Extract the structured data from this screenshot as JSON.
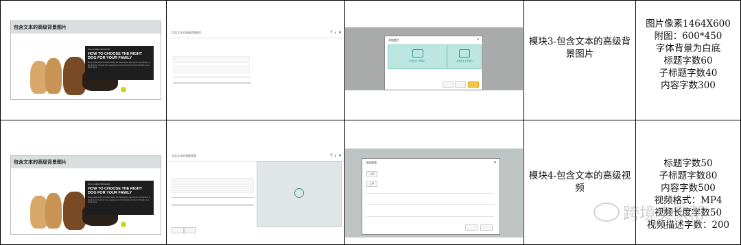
{
  "rows": [
    {
      "preview_title": "包含文本的高级背景图片",
      "overlay_small": "DOG CARE PROGRAM",
      "overlay_heading": "HOW TO CHOOSE THE RIGHT DOG FOR YOUR FAMILY",
      "overlay_body": "Many people know a lot about dogs, but choosing the right dog for your family is a big decision. Consider size, energy level and temperament before bringing a new friend home.",
      "editor_title": "包含文本的高级背景图片",
      "dialog_title": "添加图片",
      "dialog_upload_label": "点击此处上传图片",
      "module_name": "模块3-包含文本的高级背景图片",
      "specs": [
        "图片像素1464X600",
        "附图：600*450",
        "字体背景为白底",
        "标题字数60",
        "子标题字数40",
        "内容字数300"
      ]
    },
    {
      "preview_title": "包含文本的高级背景图片",
      "overlay_small": "DOG CARE PROGRAM",
      "overlay_heading": "HOW TO CHOOSE THE RIGHT DOG FOR YOUR FAMILY",
      "overlay_body": "Many people know a lot about dogs, but choosing the right dog for your family is a big decision. Consider size, energy level and temperament before bringing a new friend home.",
      "editor_title": "包含文本的高级视频",
      "dialog_title": "添加视频",
      "dialog_upload_label": "上传",
      "module_name": "模块4-包含文本的高级视频",
      "specs": [
        "标题字数50",
        "子标题字数80",
        "内容字数500",
        "视频格式：MP4",
        "视频长度字数50",
        "视频描述字数：200"
      ]
    }
  ],
  "watermark": "跨境卖家帮"
}
